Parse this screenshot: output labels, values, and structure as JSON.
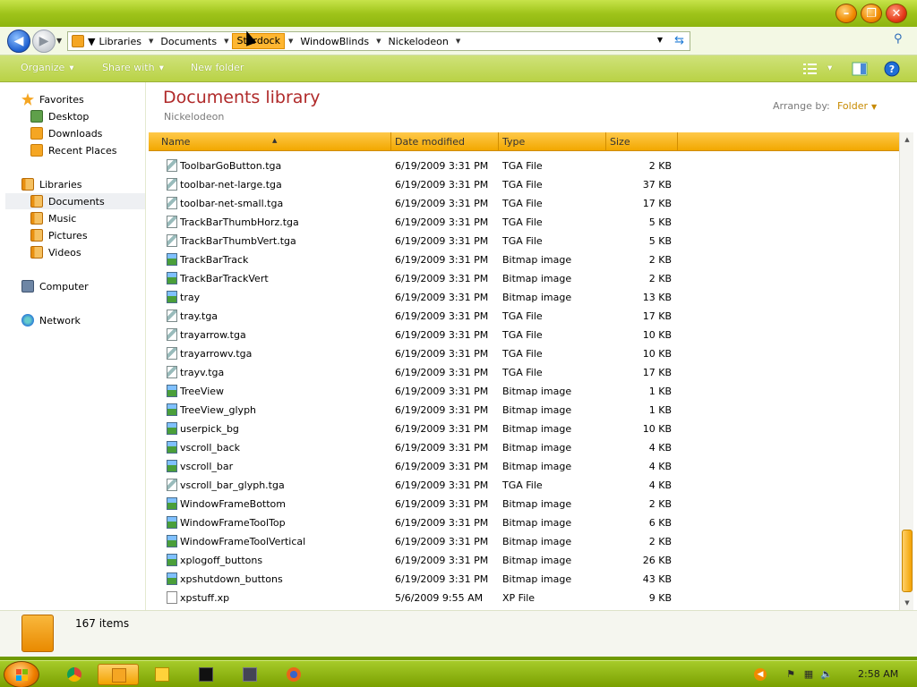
{
  "window": {
    "controls": {
      "minimize": "–",
      "maximize": "❐",
      "close": "✕"
    }
  },
  "address": {
    "breadcrumbs": [
      {
        "label": "Libraries",
        "highlighted": false
      },
      {
        "label": "Documents",
        "highlighted": false
      },
      {
        "label": "Stardock",
        "highlighted": true
      },
      {
        "label": "WindowBlinds",
        "highlighted": false
      },
      {
        "label": "Nickelodeon",
        "highlighted": false
      }
    ]
  },
  "toolbar": {
    "organize": "Organize",
    "share_with": "Share with",
    "new_folder": "New folder"
  },
  "nav": {
    "favorites_header": "Favorites",
    "favorites": [
      "Desktop",
      "Downloads",
      "Recent Places"
    ],
    "libraries_header": "Libraries",
    "libraries": [
      "Documents",
      "Music",
      "Pictures",
      "Videos"
    ],
    "computer": "Computer",
    "network": "Network",
    "selected": "Documents"
  },
  "library": {
    "title": "Documents library",
    "subtitle": "Nickelodeon",
    "arrange_label": "Arrange by:",
    "arrange_value": "Folder"
  },
  "columns": {
    "name": "Name",
    "date": "Date modified",
    "type": "Type",
    "size": "Size"
  },
  "files": [
    {
      "name": "ToolbarGoButton.tga",
      "date": "6/19/2009 3:31 PM",
      "type": "TGA File",
      "size": "2 KB",
      "icon": "tga"
    },
    {
      "name": "toolbar-net-large.tga",
      "date": "6/19/2009 3:31 PM",
      "type": "TGA File",
      "size": "37 KB",
      "icon": "tga"
    },
    {
      "name": "toolbar-net-small.tga",
      "date": "6/19/2009 3:31 PM",
      "type": "TGA File",
      "size": "17 KB",
      "icon": "tga"
    },
    {
      "name": "TrackBarThumbHorz.tga",
      "date": "6/19/2009 3:31 PM",
      "type": "TGA File",
      "size": "5 KB",
      "icon": "tga"
    },
    {
      "name": "TrackBarThumbVert.tga",
      "date": "6/19/2009 3:31 PM",
      "type": "TGA File",
      "size": "5 KB",
      "icon": "tga"
    },
    {
      "name": "TrackBarTrack",
      "date": "6/19/2009 3:31 PM",
      "type": "Bitmap image",
      "size": "2 KB",
      "icon": "bmp"
    },
    {
      "name": "TrackBarTrackVert",
      "date": "6/19/2009 3:31 PM",
      "type": "Bitmap image",
      "size": "2 KB",
      "icon": "bmp"
    },
    {
      "name": "tray",
      "date": "6/19/2009 3:31 PM",
      "type": "Bitmap image",
      "size": "13 KB",
      "icon": "bmp"
    },
    {
      "name": "tray.tga",
      "date": "6/19/2009 3:31 PM",
      "type": "TGA File",
      "size": "17 KB",
      "icon": "tga"
    },
    {
      "name": "trayarrow.tga",
      "date": "6/19/2009 3:31 PM",
      "type": "TGA File",
      "size": "10 KB",
      "icon": "tga"
    },
    {
      "name": "trayarrowv.tga",
      "date": "6/19/2009 3:31 PM",
      "type": "TGA File",
      "size": "10 KB",
      "icon": "tga"
    },
    {
      "name": "trayv.tga",
      "date": "6/19/2009 3:31 PM",
      "type": "TGA File",
      "size": "17 KB",
      "icon": "tga"
    },
    {
      "name": "TreeView",
      "date": "6/19/2009 3:31 PM",
      "type": "Bitmap image",
      "size": "1 KB",
      "icon": "bmp"
    },
    {
      "name": "TreeView_glyph",
      "date": "6/19/2009 3:31 PM",
      "type": "Bitmap image",
      "size": "1 KB",
      "icon": "bmp"
    },
    {
      "name": "userpick_bg",
      "date": "6/19/2009 3:31 PM",
      "type": "Bitmap image",
      "size": "10 KB",
      "icon": "bmp"
    },
    {
      "name": "vscroll_back",
      "date": "6/19/2009 3:31 PM",
      "type": "Bitmap image",
      "size": "4 KB",
      "icon": "bmp"
    },
    {
      "name": "vscroll_bar",
      "date": "6/19/2009 3:31 PM",
      "type": "Bitmap image",
      "size": "4 KB",
      "icon": "bmp"
    },
    {
      "name": "vscroll_bar_glyph.tga",
      "date": "6/19/2009 3:31 PM",
      "type": "TGA File",
      "size": "4 KB",
      "icon": "tga"
    },
    {
      "name": "WindowFrameBottom",
      "date": "6/19/2009 3:31 PM",
      "type": "Bitmap image",
      "size": "2 KB",
      "icon": "bmp"
    },
    {
      "name": "WindowFrameToolTop",
      "date": "6/19/2009 3:31 PM",
      "type": "Bitmap image",
      "size": "6 KB",
      "icon": "bmp"
    },
    {
      "name": "WindowFrameToolVertical",
      "date": "6/19/2009 3:31 PM",
      "type": "Bitmap image",
      "size": "2 KB",
      "icon": "bmp"
    },
    {
      "name": "xplogoff_buttons",
      "date": "6/19/2009 3:31 PM",
      "type": "Bitmap image",
      "size": "26 KB",
      "icon": "bmp"
    },
    {
      "name": "xpshutdown_buttons",
      "date": "6/19/2009 3:31 PM",
      "type": "Bitmap image",
      "size": "43 KB",
      "icon": "bmp"
    },
    {
      "name": "xpstuff.xp",
      "date": "5/6/2009 9:55 AM",
      "type": "XP File",
      "size": "9 KB",
      "icon": "xp"
    }
  ],
  "details": {
    "count": "167 items"
  },
  "taskbar": {
    "clock": "2:58 AM",
    "apps": [
      "chrome-icon",
      "explorer-icon",
      "media-player-icon",
      "cmd-icon",
      "remote-icon",
      "firefox-icon"
    ]
  }
}
